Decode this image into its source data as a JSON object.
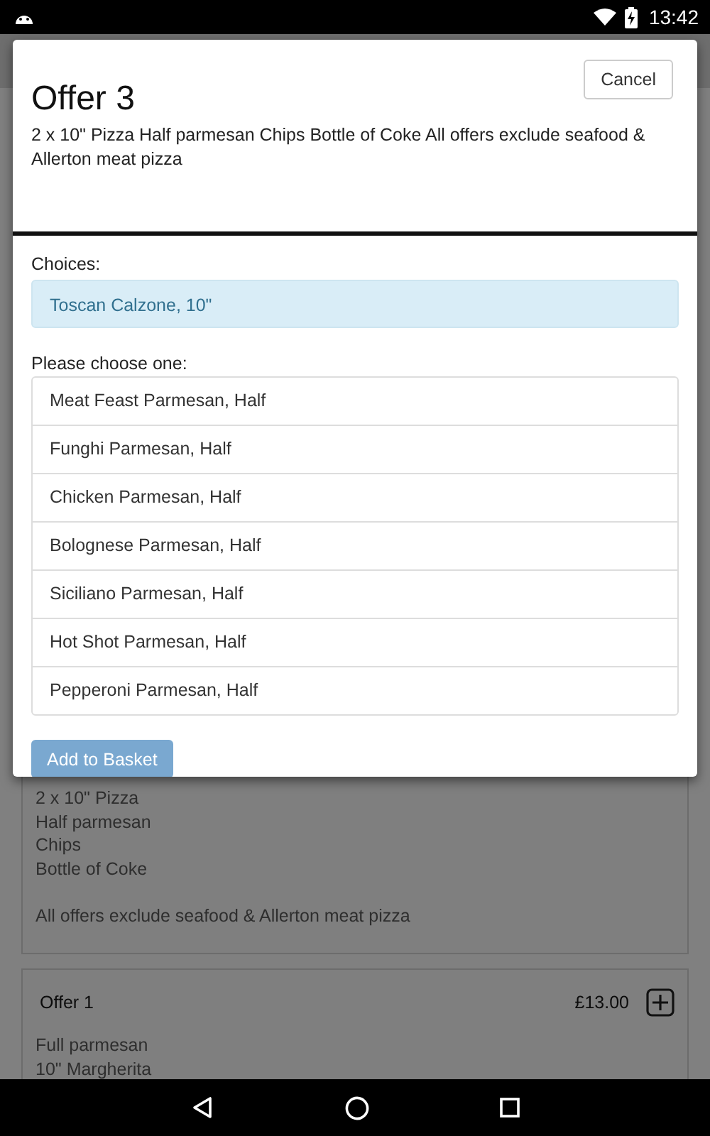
{
  "status_bar": {
    "time": "13:42"
  },
  "background": {
    "cards": [
      {
        "lines": [
          "2 x 10\" Pizza",
          "Half parmesan",
          "Chips",
          "Bottle of Coke"
        ],
        "note": "All offers exclude seafood & Allerton meat pizza"
      },
      {
        "title": "Offer 1",
        "price": "£13.00",
        "lines": [
          "Full parmesan",
          "10\" Margherita"
        ]
      }
    ]
  },
  "dialog": {
    "title": "Offer 3",
    "cancel": "Cancel",
    "description": "2 x 10\" Pizza Half parmesan Chips Bottle of Coke All offers exclude seafood & Allerton meat pizza",
    "choices_label": "Choices:",
    "choices": [
      "Toscan Calzone, 10\""
    ],
    "options_label": "Please choose one:",
    "options": [
      "Meat Feast Parmesan, Half",
      "Funghi Parmesan, Half",
      "Chicken Parmesan, Half",
      "Bolognese Parmesan, Half",
      "Siciliano Parmesan, Half",
      "Hot Shot Parmesan, Half",
      "Pepperoni Parmesan, Half"
    ],
    "add_button": {
      "label": "Add to Basket",
      "disabled": true
    }
  }
}
